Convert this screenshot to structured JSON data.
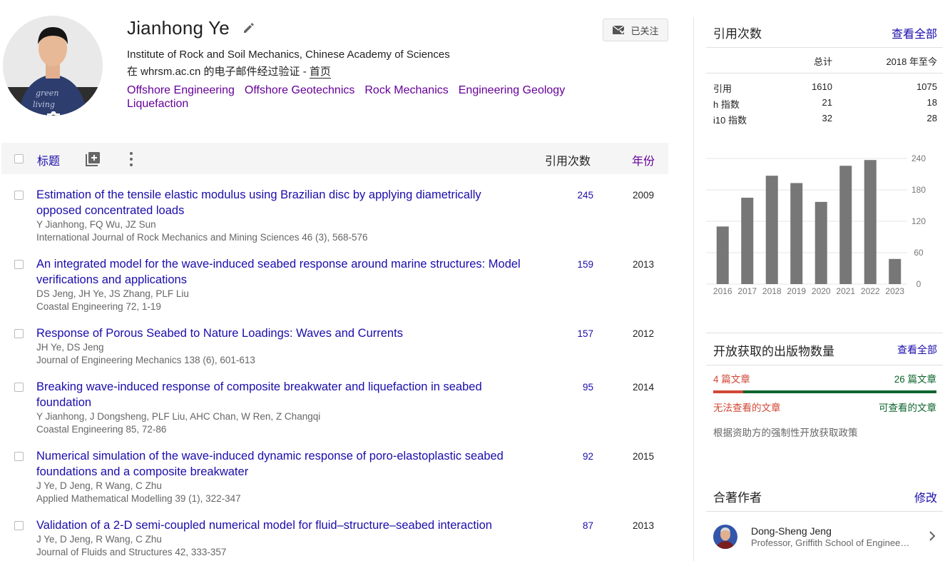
{
  "profile": {
    "name": "Jianhong Ye",
    "affiliation": "Institute of Rock and Soil Mechanics, Chinese Academy of Sciences",
    "verify_prefix": "在 whrsm.ac.cn 的电子邮件经过验证 - ",
    "homepage_label": "首页",
    "follow_label": "已关注",
    "interests": [
      "Offshore Engineering",
      "Offshore Geotechnics",
      "Rock Mechanics",
      "Engineering Geology",
      "Liquefaction"
    ]
  },
  "table": {
    "title_label": "标题",
    "cites_label": "引用次数",
    "year_label": "年份"
  },
  "articles": [
    {
      "title": "Estimation of the tensile elastic modulus using Brazilian disc by applying diametrically opposed concentrated loads",
      "authors": "Y Jianhong, FQ Wu, JZ Sun",
      "venue": "International Journal of Rock Mechanics and Mining Sciences 46 (3), 568-576",
      "cites": "245",
      "year": "2009"
    },
    {
      "title": "An integrated model for the wave-induced seabed response around marine structures: Model verifications and applications",
      "authors": "DS Jeng, JH Ye, JS Zhang, PLF Liu",
      "venue": "Coastal Engineering 72, 1-19",
      "cites": "159",
      "year": "2013"
    },
    {
      "title": "Response of Porous Seabed to Nature Loadings: Waves and Currents",
      "authors": "JH Ye, DS Jeng",
      "venue": "Journal of Engineering Mechanics 138 (6), 601-613",
      "cites": "157",
      "year": "2012"
    },
    {
      "title": "Breaking wave-induced response of composite breakwater and liquefaction in seabed foundation",
      "authors": "Y Jianhong, J Dongsheng, PLF Liu, AHC Chan, W Ren, Z Changqi",
      "venue": "Coastal Engineering 85, 72-86",
      "cites": "95",
      "year": "2014"
    },
    {
      "title": "Numerical simulation of the wave-induced dynamic response of poro-elastoplastic seabed foundations and a composite breakwater",
      "authors": "J Ye, D Jeng, R Wang, C Zhu",
      "venue": "Applied Mathematical Modelling 39 (1), 322-347",
      "cites": "92",
      "year": "2015"
    },
    {
      "title": "Validation of a 2-D semi-coupled numerical model for fluid–structure–seabed interaction",
      "authors": "J Ye, D Jeng, R Wang, C Zhu",
      "venue": "Journal of Fluids and Structures 42, 333-357",
      "cites": "87",
      "year": "2013"
    }
  ],
  "sidebar": {
    "cited_by": {
      "heading": "引用次数",
      "view_all": "查看全部",
      "col_all": "总计",
      "col_since": "2018 年至今",
      "rows": [
        {
          "label": "引用",
          "all": "1610",
          "since": "1075"
        },
        {
          "label": "h 指数",
          "all": "21",
          "since": "18"
        },
        {
          "label": "i10 指数",
          "all": "32",
          "since": "28"
        }
      ]
    },
    "open_access": {
      "heading": "开放获取的出版物数量",
      "view_all": "查看全部",
      "unavailable_count": "4 篇文章",
      "available_count": "26 篇文章",
      "unavailable_label": "无法查看的文章",
      "available_label": "可查看的文章",
      "policy": "根据资助方的强制性开放获取政策",
      "unavailable_fraction": 0.133
    },
    "coauthors": {
      "heading": "合著作者",
      "edit": "修改",
      "items": [
        {
          "name": "Dong-Sheng Jeng",
          "affiliation": "Professor, Griffith School of Engineering"
        }
      ]
    }
  },
  "chart_data": {
    "type": "bar",
    "categories": [
      "2016",
      "2017",
      "2018",
      "2019",
      "2020",
      "2021",
      "2022",
      "2023"
    ],
    "values": [
      110,
      165,
      207,
      193,
      157,
      226,
      237,
      48
    ],
    "ylim": [
      0,
      240
    ],
    "yticks": [
      "0",
      "60",
      "120",
      "180",
      "240"
    ],
    "grid": true,
    "bar_color": "#777777"
  },
  "colors": {
    "link": "#1a0dab",
    "visited": "#660099",
    "oa_red": "#d14836",
    "oa_green": "#0d652d"
  }
}
